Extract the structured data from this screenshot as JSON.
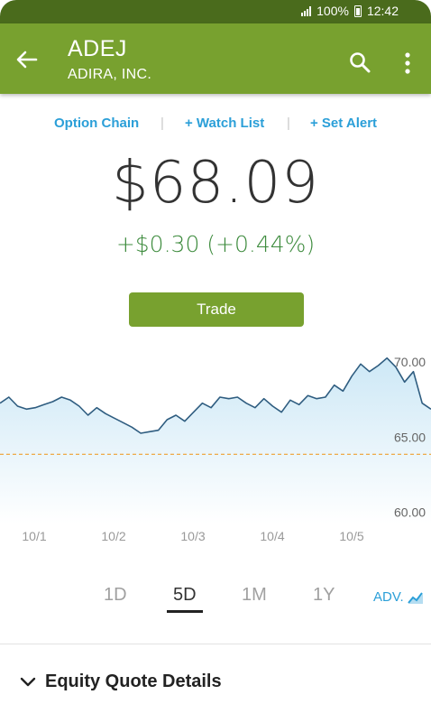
{
  "status": {
    "battery": "100%",
    "time": "12:42"
  },
  "header": {
    "ticker": "ADEJ",
    "company": "ADIRA, INC."
  },
  "links": {
    "option_chain": "Option Chain",
    "watch_list": "+ Watch List",
    "set_alert": "+ Set Alert",
    "separator": "|"
  },
  "quote": {
    "price": "$68.09",
    "change": "+$0.30 (+0.44%)"
  },
  "trade_label": "Trade",
  "chart_data": {
    "type": "area",
    "x_labels": [
      "10/1",
      "10/2",
      "10/3",
      "10/4",
      "10/5"
    ],
    "y_ticks": [
      "70.00",
      "65.00",
      "60.00"
    ],
    "ylim": [
      59.2,
      70.6
    ],
    "reference_line": 63.8,
    "series": [
      {
        "values": [
          67.2,
          67.6,
          67.0,
          66.8,
          66.9,
          67.1,
          67.3,
          67.6,
          67.4,
          67.0,
          66.4,
          66.9,
          66.5,
          66.2,
          65.9,
          65.6,
          65.2,
          65.3,
          65.4,
          66.1,
          66.4,
          66.0,
          66.6,
          67.2,
          66.9,
          67.6,
          67.5,
          67.6,
          67.2,
          66.9,
          67.5,
          67.0,
          66.6,
          67.4,
          67.1,
          67.7,
          67.5,
          67.6,
          68.4,
          68.0,
          69.0,
          69.8,
          69.3,
          69.7,
          70.2,
          69.6,
          68.6,
          69.3,
          67.2,
          66.8
        ]
      }
    ]
  },
  "range_tabs": [
    "1D",
    "5D",
    "1M",
    "1Y"
  ],
  "active_range": "5D",
  "adv_label": "ADV.",
  "details_label": "Equity Quote Details",
  "colors": {
    "brand_green": "#78a12f",
    "link_blue": "#2b9fd8",
    "gain_green": "#3d8b3d",
    "line": "#2f5d80",
    "reference": "#f0a030"
  }
}
